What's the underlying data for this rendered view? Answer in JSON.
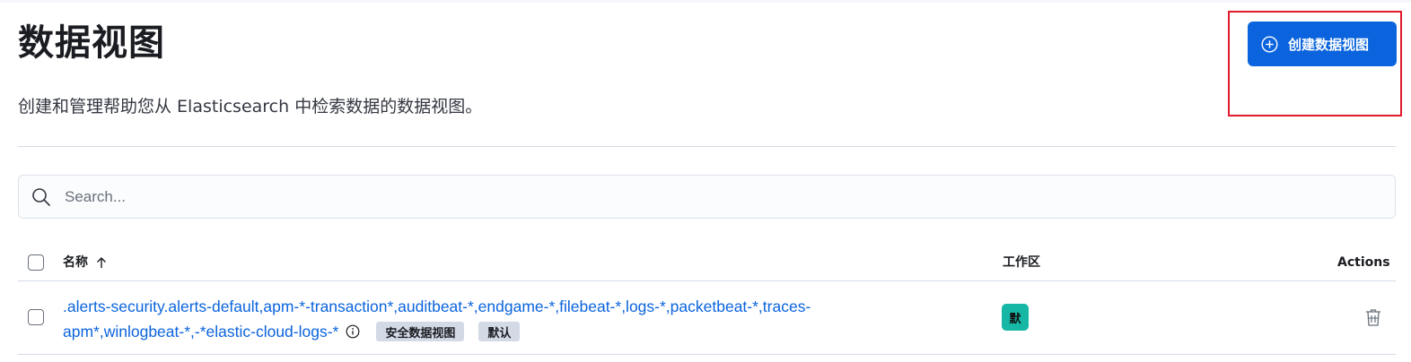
{
  "header": {
    "title": "数据视图",
    "description": "创建和管理帮助您从 Elasticsearch 中检索数据的数据视图。",
    "create_button_label": "创建数据视图"
  },
  "search": {
    "placeholder": "Search...",
    "value": ""
  },
  "table": {
    "columns": {
      "name": "名称",
      "workspace": "工作区",
      "actions": "Actions"
    },
    "sort": {
      "column": "名称",
      "direction": "ascending"
    },
    "rows": [
      {
        "name_line1": ".alerts-security.alerts-default,apm-*-transaction*,auditbeat-*,endgame-*,filebeat-*,logs-*,packetbeat-*,traces-",
        "name_line2": "apm*,winlogbeat-*,-*elastic-cloud-logs-*",
        "badges": [
          "安全数据视图",
          "默认"
        ],
        "workspace_initial": "默",
        "workspace_color": "#16b8a5",
        "selected": false
      }
    ]
  },
  "icons": {
    "create": "plus-circle-icon",
    "search": "search-icon",
    "sort": "arrow-up-icon",
    "info": "info-icon",
    "delete": "trash-icon"
  },
  "colors": {
    "primary": "#0b64dd",
    "highlight_box": "#e01a2b",
    "badge_bg": "#d3dae6"
  }
}
